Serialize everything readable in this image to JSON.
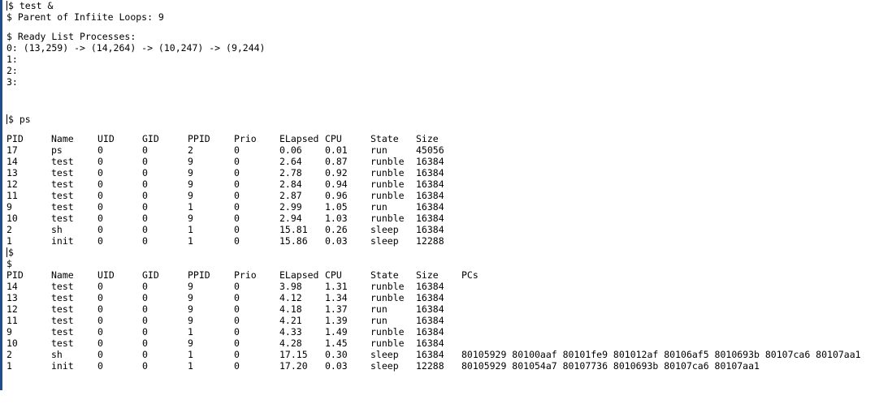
{
  "header": {
    "cmd_test": "$ test &",
    "parent_msg": "$ Parent of Infiite Loops: 9",
    "ready_title": "$ Ready List Processes:",
    "queue0": "0: (13,259) -> (14,264) -> (10,247) -> (9,244)",
    "queue1": "1:",
    "queue2": "2:",
    "queue3": "3:"
  },
  "ps_cmd": "$ ps",
  "table1": {
    "headers": [
      "PID",
      "Name",
      "UID",
      "GID",
      "PPID",
      "Prio",
      "ELapsed",
      "CPU",
      "State",
      "Size"
    ],
    "rows": [
      [
        "17",
        "ps",
        "0",
        "0",
        "2",
        "0",
        "0.06",
        "0.01",
        "run",
        "45056"
      ],
      [
        "14",
        "test",
        "0",
        "0",
        "9",
        "0",
        "2.64",
        "0.87",
        "runble",
        "16384"
      ],
      [
        "13",
        "test",
        "0",
        "0",
        "9",
        "0",
        "2.78",
        "0.92",
        "runble",
        "16384"
      ],
      [
        "12",
        "test",
        "0",
        "0",
        "9",
        "0",
        "2.84",
        "0.94",
        "runble",
        "16384"
      ],
      [
        "11",
        "test",
        "0",
        "0",
        "9",
        "0",
        "2.87",
        "0.96",
        "runble",
        "16384"
      ],
      [
        "9",
        "test",
        "0",
        "0",
        "1",
        "0",
        "2.99",
        "1.05",
        "run",
        "16384"
      ],
      [
        "10",
        "test",
        "0",
        "0",
        "9",
        "0",
        "2.94",
        "1.03",
        "runble",
        "16384"
      ],
      [
        "2",
        "sh",
        "0",
        "0",
        "1",
        "0",
        "15.81",
        "0.26",
        "sleep",
        "16384"
      ],
      [
        "1",
        "init",
        "0",
        "0",
        "1",
        "0",
        "15.86",
        "0.03",
        "sleep",
        "12288"
      ]
    ]
  },
  "prompt1": "$",
  "prompt2": "$",
  "table2": {
    "headers": [
      "PID",
      "Name",
      "UID",
      "GID",
      "PPID",
      "Prio",
      "ELapsed",
      "CPU",
      "State",
      "Size",
      "PCs"
    ],
    "rows": [
      [
        "14",
        "test",
        "0",
        "0",
        "9",
        "0",
        "3.98",
        "1.31",
        "runble",
        "16384",
        ""
      ],
      [
        "13",
        "test",
        "0",
        "0",
        "9",
        "0",
        "4.12",
        "1.34",
        "runble",
        "16384",
        ""
      ],
      [
        "12",
        "test",
        "0",
        "0",
        "9",
        "0",
        "4.18",
        "1.37",
        "run",
        "16384",
        ""
      ],
      [
        "11",
        "test",
        "0",
        "0",
        "9",
        "0",
        "4.21",
        "1.39",
        "run",
        "16384",
        ""
      ],
      [
        "9",
        "test",
        "0",
        "0",
        "1",
        "0",
        "4.33",
        "1.49",
        "runble",
        "16384",
        ""
      ],
      [
        "10",
        "test",
        "0",
        "0",
        "9",
        "0",
        "4.28",
        "1.45",
        "runble",
        "16384",
        ""
      ],
      [
        "2",
        "sh",
        "0",
        "0",
        "1",
        "0",
        "17.15",
        "0.30",
        "sleep",
        "16384",
        "80105929 80100aaf 80101fe9 801012af 80106af5 8010693b 80107ca6 80107aa1"
      ],
      [
        "1",
        "init",
        "0",
        "0",
        "1",
        "0",
        "17.20",
        "0.03",
        "sleep",
        "12288",
        "80105929 801054a7 80107736 8010693b 80107ca6 80107aa1"
      ]
    ]
  },
  "colors": {
    "background": "#ffffff",
    "text": "#000000",
    "window_edge": "#1f4e8c"
  }
}
